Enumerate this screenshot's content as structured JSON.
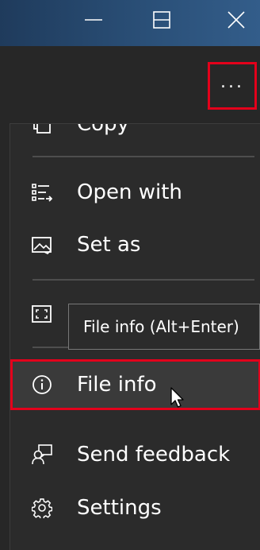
{
  "window": {
    "controls": [
      {
        "name": "minimize",
        "icon": "minimize-icon"
      },
      {
        "name": "maximize",
        "icon": "maximize-icon"
      },
      {
        "name": "close",
        "icon": "close-icon"
      }
    ]
  },
  "toolbar": {
    "more_label": "...",
    "more_icon": "more-options-icon"
  },
  "menu": {
    "items": [
      {
        "id": "copy",
        "label": "Copy",
        "icon": "copy-icon"
      },
      {
        "id": "open-with",
        "label": "Open with",
        "icon": "open-with-icon"
      },
      {
        "id": "set-as",
        "label": "Set as",
        "icon": "set-as-icon"
      },
      {
        "id": "fullscreen",
        "label": "",
        "icon": "fullscreen-icon"
      },
      {
        "id": "file-info",
        "label": "File info",
        "icon": "info-icon"
      },
      {
        "id": "send-feedback",
        "label": "Send feedback",
        "icon": "feedback-icon"
      },
      {
        "id": "settings",
        "label": "Settings",
        "icon": "gear-icon"
      }
    ]
  },
  "tooltip": {
    "text": "File info (Alt+Enter)"
  },
  "colors": {
    "highlight_border": "#e3001b",
    "menu_background": "#2b2b2b",
    "titlebar": "#2a4f77"
  }
}
